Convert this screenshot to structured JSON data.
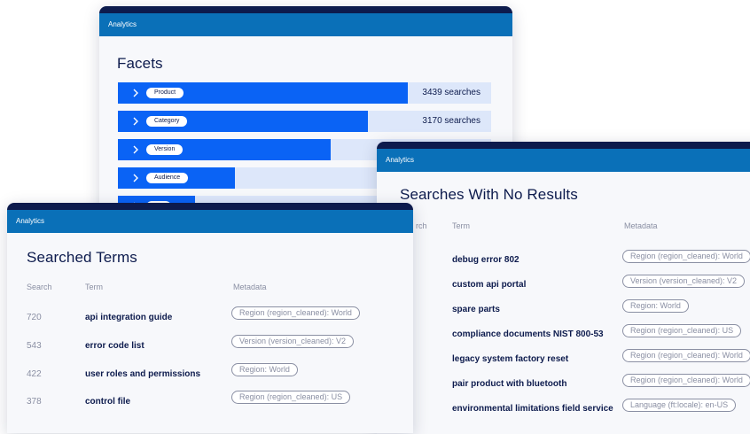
{
  "facets": {
    "header": "Analytics",
    "title": "Facets",
    "rows": [
      {
        "label": "Product",
        "count": "3439 searches",
        "fill": 0.78
      },
      {
        "label": "Category",
        "count": "3170 searches",
        "fill": 0.67
      },
      {
        "label": "Version",
        "count": "",
        "fill": 0.57
      },
      {
        "label": "Audience",
        "count": "",
        "fill": 0.31
      },
      {
        "label": "",
        "count": "",
        "fill": 0.21
      }
    ]
  },
  "no_results": {
    "header": "Analytics",
    "title": "Searches With No Results",
    "columns": {
      "search": "rch",
      "term": "Term",
      "metadata": "Metadata"
    },
    "rows": [
      {
        "term": "debug error 802",
        "meta": "Region (region_cleaned): World"
      },
      {
        "term": "custom api portal",
        "meta": "Version (version_cleaned): V2"
      },
      {
        "term": "spare parts",
        "meta": "Region: World"
      },
      {
        "term": "compliance documents NIST 800-53",
        "meta": "Region (region_cleaned): US"
      },
      {
        "term": "legacy system factory reset",
        "meta": "Region (region_cleaned): World"
      },
      {
        "term": "pair product with bluetooth",
        "meta": "Region (region_cleaned): World"
      },
      {
        "term": "environmental limitations field service",
        "meta": "Language (ft:locale): en-US"
      }
    ]
  },
  "searched_terms": {
    "header": "Analytics",
    "title": "Searched Terms",
    "columns": {
      "search": "Search",
      "term": "Term",
      "metadata": "Metadata"
    },
    "rows": [
      {
        "search": "720",
        "term": "api integration guide",
        "meta": "Region (region_cleaned): World"
      },
      {
        "search": "543",
        "term": "error code list",
        "meta": "Version (version_cleaned): V2"
      },
      {
        "search": "422",
        "term": "user roles and permissions",
        "meta": "Region: World"
      },
      {
        "search": "378",
        "term": "control file",
        "meta": "Region (region_cleaned): US"
      }
    ]
  }
}
